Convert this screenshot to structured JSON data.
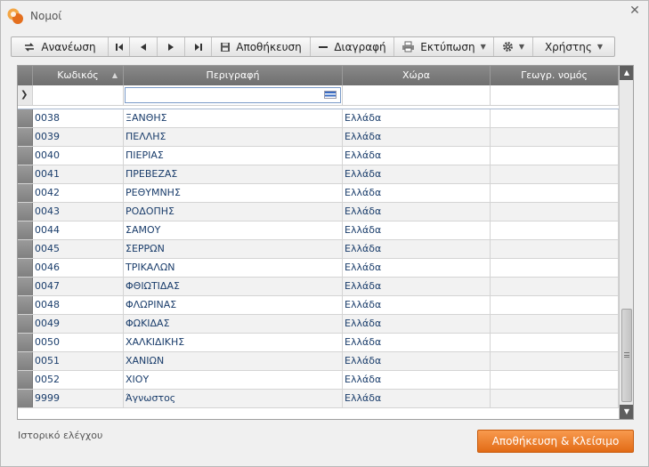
{
  "window": {
    "title": "Νομοί",
    "close_glyph": "✕"
  },
  "toolbar": {
    "refresh_label": "Ανανέωση",
    "save_label": "Αποθήκευση",
    "delete_label": "Διαγραφή",
    "print_label": "Εκτύπωση",
    "user_label": "Χρήστης"
  },
  "grid": {
    "columns": [
      "Κωδικός",
      "Περιγραφή",
      "Χώρα",
      "Γεωγρ. νομός"
    ],
    "sort_glyph": "▲",
    "rows": [
      {
        "code": "0038",
        "desc": "ΞΑΝΘΗΣ",
        "country": "Ελλάδα",
        "geo": ""
      },
      {
        "code": "0039",
        "desc": "ΠΕΛΛΗΣ",
        "country": "Ελλάδα",
        "geo": ""
      },
      {
        "code": "0040",
        "desc": "ΠΙΕΡΙΑΣ",
        "country": "Ελλάδα",
        "geo": ""
      },
      {
        "code": "0041",
        "desc": "ΠΡΕΒΕΖΑΣ",
        "country": "Ελλάδα",
        "geo": ""
      },
      {
        "code": "0042",
        "desc": "ΡΕΘΥΜΝΗΣ",
        "country": "Ελλάδα",
        "geo": ""
      },
      {
        "code": "0043",
        "desc": "ΡΟΔΟΠΗΣ",
        "country": "Ελλάδα",
        "geo": ""
      },
      {
        "code": "0044",
        "desc": "ΣΑΜΟΥ",
        "country": "Ελλάδα",
        "geo": ""
      },
      {
        "code": "0045",
        "desc": "ΣΕΡΡΩΝ",
        "country": "Ελλάδα",
        "geo": ""
      },
      {
        "code": "0046",
        "desc": "ΤΡΙΚΑΛΩΝ",
        "country": "Ελλάδα",
        "geo": ""
      },
      {
        "code": "0047",
        "desc": "ΦΘΙΩΤΙΔΑΣ",
        "country": "Ελλάδα",
        "geo": ""
      },
      {
        "code": "0048",
        "desc": "ΦΛΩΡΙΝΑΣ",
        "country": "Ελλάδα",
        "geo": ""
      },
      {
        "code": "0049",
        "desc": "ΦΩΚΙΔΑΣ",
        "country": "Ελλάδα",
        "geo": ""
      },
      {
        "code": "0050",
        "desc": "ΧΑΛΚΙΔΙΚΗΣ",
        "country": "Ελλάδα",
        "geo": ""
      },
      {
        "code": "0051",
        "desc": "ΧΑΝΙΩΝ",
        "country": "Ελλάδα",
        "geo": ""
      },
      {
        "code": "0052",
        "desc": "ΧΙΟΥ",
        "country": "Ελλάδα",
        "geo": ""
      },
      {
        "code": "9999",
        "desc": "Άγνωστος",
        "country": "Ελλάδα",
        "geo": ""
      }
    ]
  },
  "footer": {
    "audit_label": "Ιστορικό ελέγχου",
    "save_close_label": "Αποθήκευση & Κλείσιμο"
  },
  "colors": {
    "accent": "#e8731f",
    "header": "#7d7d7d",
    "cell_text": "#1a3d6b"
  }
}
